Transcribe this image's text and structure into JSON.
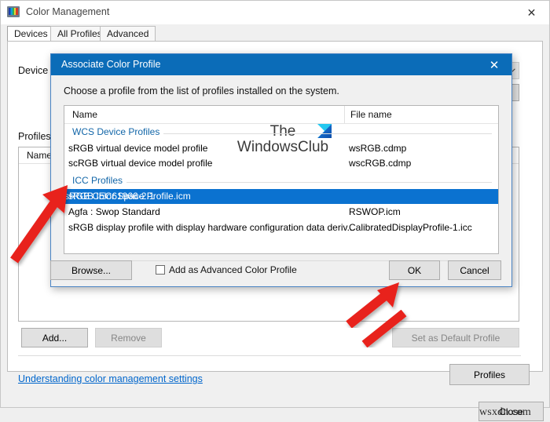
{
  "window": {
    "title": "Color Management",
    "icon": "monitor-color-icon",
    "close_label": "✕",
    "tabs": [
      {
        "label": "Devices",
        "active": true
      },
      {
        "label": "All Profiles",
        "active": false
      },
      {
        "label": "Advanced",
        "active": false
      }
    ],
    "device_label": "Device:",
    "profiles_label": "Profiles associated with this device:",
    "profiles_label_short": "Profiles",
    "device_label_short": "Device",
    "list_column_name": "Name",
    "buttons": {
      "add": "Add...",
      "remove": "Remove",
      "set_default": "Set as Default Profile",
      "profiles": "Profiles",
      "close": "Close"
    },
    "help_link": "Understanding color management settings"
  },
  "dialog": {
    "title": "Associate Color Profile",
    "close_label": "✕",
    "instruction": "Choose a profile from the list of profiles installed on the system.",
    "columns": {
      "name": "Name",
      "file_name": "File name"
    },
    "groups": [
      {
        "label": "WCS Device Profiles",
        "rows": [
          {
            "name": "sRGB virtual device model profile",
            "file": "wsRGB.cdmp",
            "selected": false
          },
          {
            "name": "scRGB virtual device model profile",
            "file": "wscRGB.cdmp",
            "selected": false
          }
        ]
      },
      {
        "label": "ICC Profiles",
        "rows": [
          {
            "name": "sRGB IEC61966-2.1",
            "file": "sRGB Color Space Profile.icm",
            "selected": true
          },
          {
            "name": "Agfa : Swop Standard",
            "file": "RSWOP.icm",
            "selected": false
          },
          {
            "name": "sRGB display profile with display hardware configuration data deriv...",
            "file": "CalibratedDisplayProfile-1.icc",
            "selected": false
          }
        ]
      }
    ],
    "buttons": {
      "browse": "Browse...",
      "ok": "OK",
      "cancel": "Cancel"
    },
    "checkbox_label": "Add as Advanced Color Profile",
    "checkbox_checked": false
  },
  "watermarks": {
    "center_line1": "The",
    "center_line2": "WindowsClub",
    "bottom_right": "wsxdn.com"
  },
  "colors": {
    "accent_blue": "#0b72d0",
    "dialog_title_blue": "#0b6cb8",
    "group_label_blue": "#1266a8",
    "link_blue": "#0066cc",
    "arrow_red": "#e8241c"
  }
}
